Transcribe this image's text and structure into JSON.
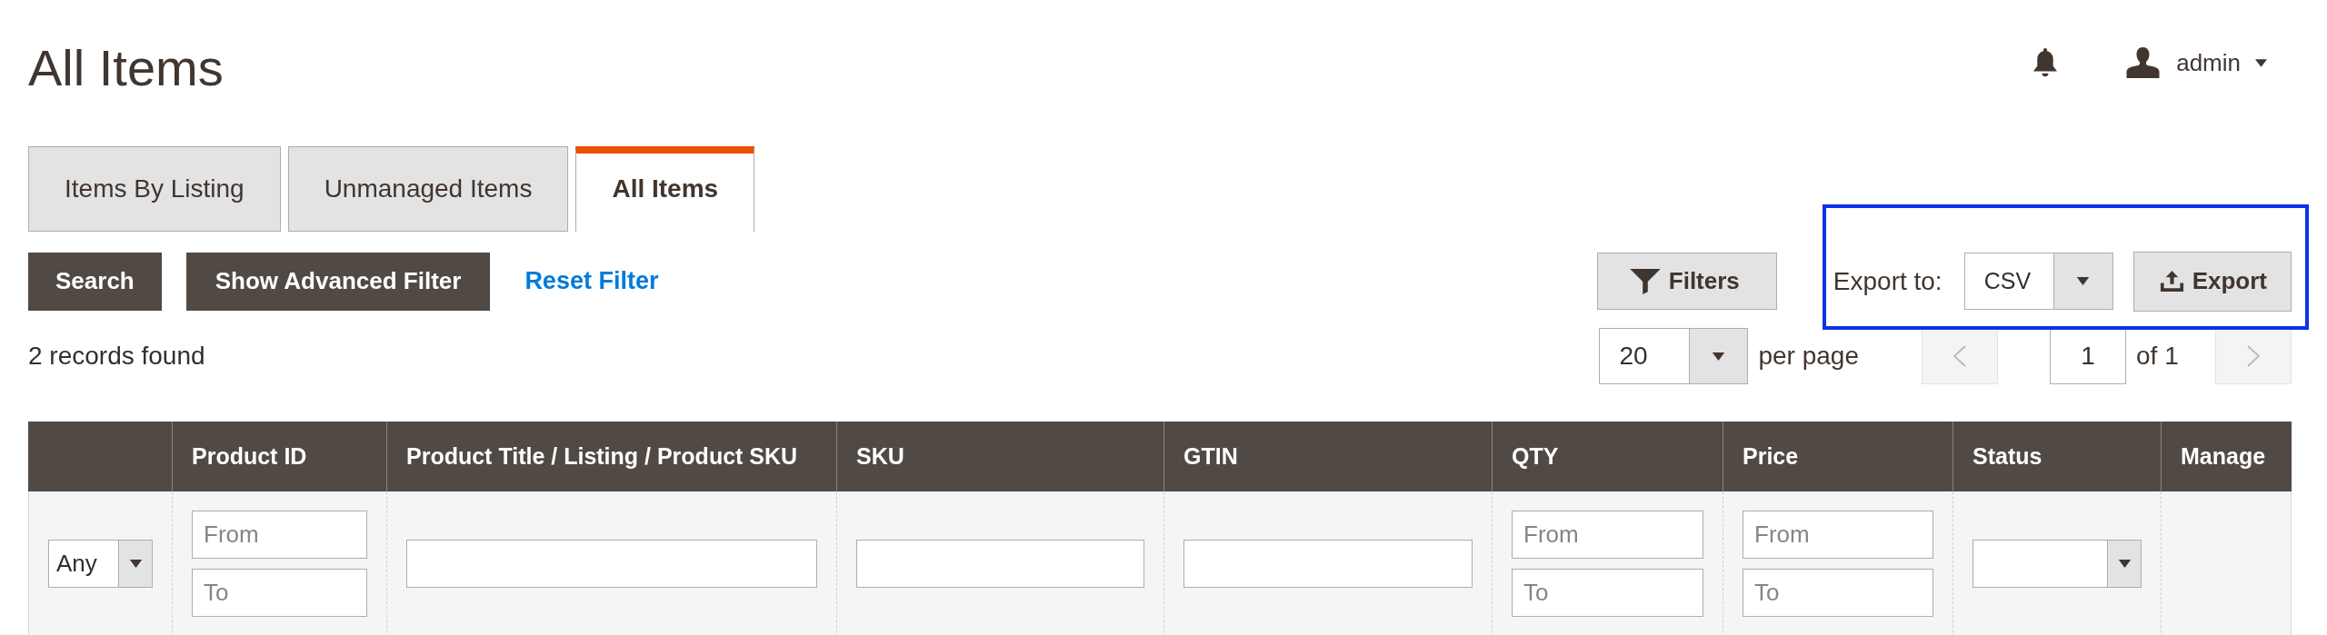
{
  "header": {
    "title": "All Items",
    "user": {
      "name": "admin"
    }
  },
  "tabs": [
    {
      "label": "Items By Listing",
      "selected": false
    },
    {
      "label": "Unmanaged Items",
      "selected": false
    },
    {
      "label": "All Items",
      "selected": true
    }
  ],
  "actions": {
    "search": "Search",
    "advanced_filter": "Show Advanced Filter",
    "reset_filter": "Reset Filter",
    "filters": "Filters"
  },
  "export": {
    "label": "Export to:",
    "format": "CSV",
    "button": "Export"
  },
  "records_found": "2 records found",
  "pager": {
    "per_page": "20",
    "per_page_label": "per page",
    "prev": {
      "disabled": true
    },
    "page": "1",
    "total": "of 1",
    "next": {
      "disabled": true
    }
  },
  "table": {
    "columns": [
      {
        "filter": {
          "kind": "select",
          "value": "Any"
        }
      },
      {
        "label": "Product ID",
        "filter": {
          "kind": "range",
          "from": {
            "placeholder": "From"
          },
          "to": {
            "placeholder": "To"
          }
        }
      },
      {
        "label": "Product Title / Listing / Product SKU",
        "filter": {
          "kind": "text"
        }
      },
      {
        "label": "SKU",
        "filter": {
          "kind": "text"
        }
      },
      {
        "label": "GTIN",
        "filter": {
          "kind": "text"
        }
      },
      {
        "label": "QTY",
        "filter": {
          "kind": "range",
          "from": {
            "placeholder": "From"
          },
          "to": {
            "placeholder": "To"
          }
        }
      },
      {
        "label": "Price",
        "filter": {
          "kind": "range",
          "from": {
            "placeholder": "From"
          },
          "to": {
            "placeholder": "To"
          }
        }
      },
      {
        "label": "Status",
        "filter": {
          "kind": "select"
        }
      },
      {
        "label": "Manage"
      }
    ]
  }
}
